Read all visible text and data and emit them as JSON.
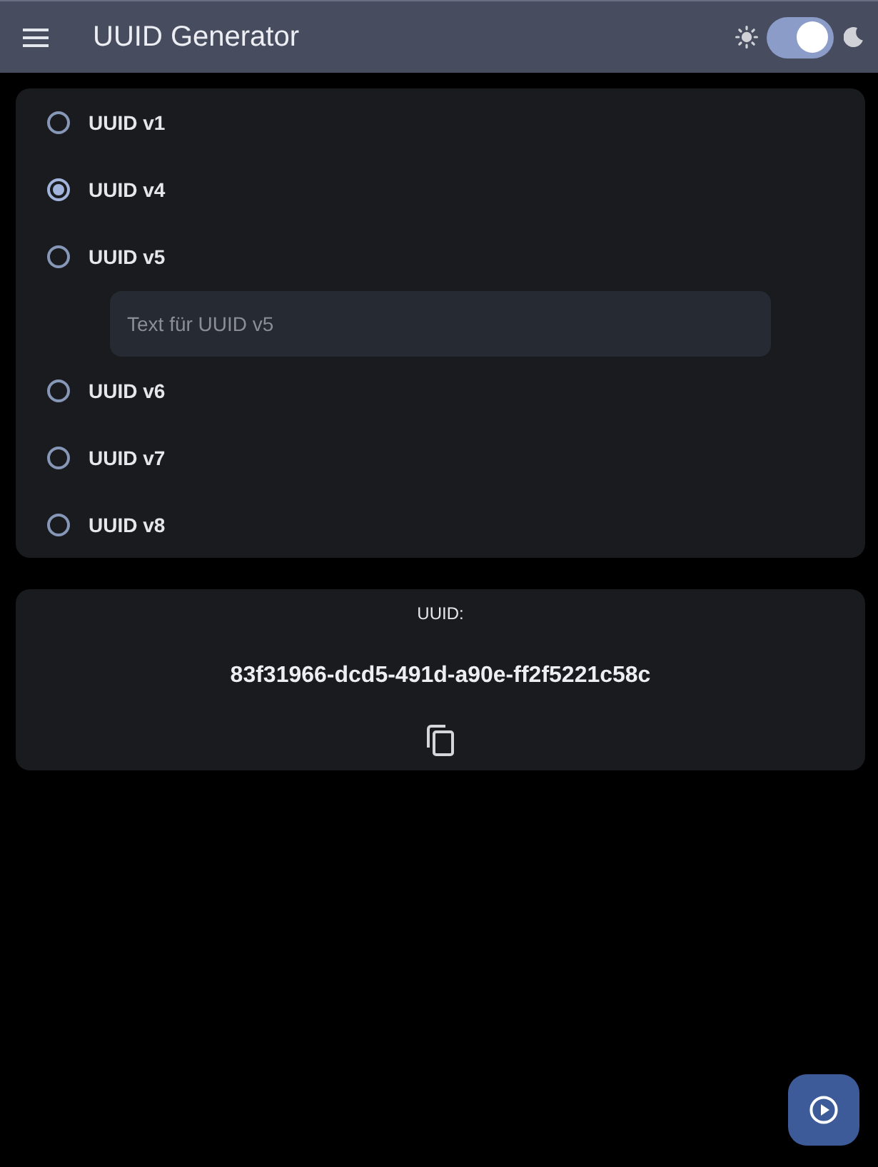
{
  "app_bar": {
    "title": "UUID Generator",
    "theme_toggle": {
      "on": true
    }
  },
  "versions": [
    {
      "label": "UUID v1",
      "selected": false
    },
    {
      "label": "UUID v4",
      "selected": true
    },
    {
      "label": "UUID v5",
      "selected": false,
      "text_field": {
        "placeholder": "Text für UUID v5"
      }
    },
    {
      "label": "UUID v6",
      "selected": false
    },
    {
      "label": "UUID v7",
      "selected": false
    },
    {
      "label": "UUID v8",
      "selected": false
    }
  ],
  "result": {
    "label": "UUID:",
    "value": "83f31966-dcd5-491d-a90e-ff2f5221c58c"
  }
}
